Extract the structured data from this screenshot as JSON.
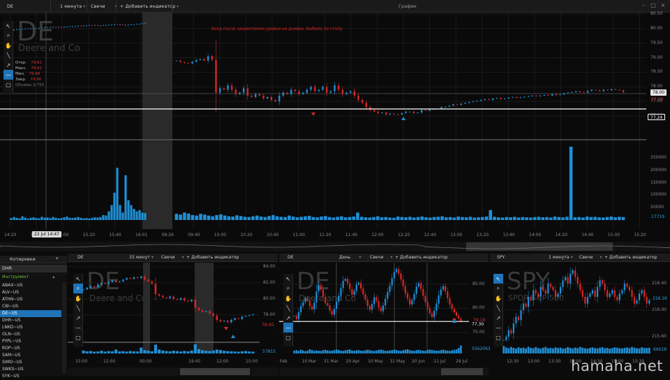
{
  "topbar": {
    "symbol": "DE",
    "interval": "1 минута",
    "chart_type": "Свечи",
    "add_indicator": "+ Добавить индикатор",
    "window_title": "График"
  },
  "main_chart": {
    "watermark": "DE",
    "company": "Deere and Co",
    "ohlc": [
      {
        "label": "Откр.",
        "value": "79.62"
      },
      {
        "label": "Макс.",
        "value": "79.62"
      },
      {
        "label": "Мин.",
        "value": "79.66"
      },
      {
        "label": "Закр.",
        "value": "79.66"
      }
    ],
    "volume_label": "Объемы",
    "volume_value": "9,755",
    "annotation": "Вход после закрепления уровня на дневке. Выбило по стопу",
    "price_ticks": [
      "80.50",
      "80.00",
      "79.50",
      "79.00",
      "78.50",
      "78.00",
      "77.50",
      "77.00"
    ],
    "current_price": "78.00",
    "level_price": "77.24",
    "stop_price": "77.79",
    "volume_ticks": [
      "250000",
      "200000",
      "150000",
      "100000",
      "50000"
    ],
    "last_volume": "17719",
    "time_ticks": [
      "14:20",
      "14:40",
      "15:00",
      "15:20",
      "15:40",
      "16:01",
      "08:26",
      "09:40",
      "10:00",
      "10:20",
      "10:40",
      "11:00",
      "11:20",
      "11:40",
      "12:00",
      "12:20",
      "12:40",
      "13:00",
      "13:20",
      "13:40",
      "14:00",
      "14:20",
      "14:40",
      "15:00",
      "15:20"
    ],
    "cursor_time": "22 Jul 14:47",
    "candles": [
      79.94,
      79.96,
      79.97,
      79.98,
      80.0,
      80.0,
      79.99,
      80.0,
      80.01,
      80.01,
      80.02,
      80.03,
      80.05,
      80.04,
      80.05,
      80.06,
      80.05,
      80.06,
      80.05,
      80.06,
      80.07,
      80.08,
      80.08,
      80.08,
      80.1,
      80.09,
      80.1,
      80.11,
      80.12,
      80.11,
      80.12,
      80.11,
      80.11,
      80.12,
      80.12,
      80.13,
      80.13,
      80.15,
      80.14,
      80.14,
      80.12,
      80.13,
      80.13,
      80.14,
      80.15,
      80.16,
      80.16,
      80.18,
      80.2,
      78.9,
      78.85,
      78.82,
      78.8,
      78.86,
      78.92,
      78.95,
      78.9,
      79.05,
      78.93,
      77.8,
      77.95,
      77.9,
      78.05,
      77.9,
      77.75,
      77.8,
      77.95,
      77.7,
      77.65,
      77.75,
      77.7,
      77.6,
      77.65,
      77.55,
      77.5,
      77.7,
      77.8,
      77.75,
      77.9,
      77.85,
      77.75,
      77.8,
      77.9,
      78.0,
      77.85,
      77.9,
      78.0,
      77.8,
      77.85,
      78.05,
      77.9,
      77.75,
      77.8,
      77.85,
      77.7,
      77.55,
      77.45,
      77.3,
      77.2,
      77.15,
      77.1,
      77.12,
      77.05,
      77.08,
      77.06,
      77.05,
      77.1,
      77.15,
      77.15,
      77.1,
      77.12,
      77.2,
      77.18,
      77.22,
      77.24,
      77.25,
      77.3,
      77.32,
      77.35,
      77.4,
      77.38,
      77.42,
      77.45,
      77.48,
      77.5,
      77.52,
      77.55,
      77.58,
      77.55,
      77.6,
      77.62,
      77.58,
      77.6,
      77.63,
      77.65,
      77.62,
      77.64,
      77.66,
      77.68,
      77.7,
      77.68,
      77.7,
      77.72,
      77.7,
      77.75,
      77.72,
      77.74,
      77.78,
      77.8,
      77.82,
      77.85,
      77.82,
      77.8,
      77.86,
      77.9,
      77.88,
      77.85,
      77.9,
      77.88,
      77.92,
      77.9,
      77.88,
      77.82
    ],
    "volumes": [
      8000,
      12000,
      9000,
      7000,
      15000,
      10000,
      6000,
      9000,
      11000,
      8000,
      7000,
      13000,
      9000,
      10000,
      8000,
      12000,
      9000,
      7000,
      8000,
      11000,
      14000,
      9000,
      8000,
      10000,
      12000,
      9000,
      7000,
      8000,
      6000,
      9000,
      11000,
      10000,
      12000,
      20000,
      18000,
      35000,
      60000,
      110000,
      210000,
      60000,
      30000,
      180000,
      80000,
      60000,
      45000,
      35000,
      40000,
      30000,
      28000,
      25000,
      22000,
      30000,
      26000,
      20000,
      18000,
      25000,
      22000,
      18000,
      15000,
      20000,
      23000,
      18000,
      15000,
      14000,
      19000,
      16000,
      13000,
      12000,
      15000,
      18000,
      14000,
      12000,
      16000,
      20000,
      15000,
      13000,
      12000,
      18000,
      14000,
      11000,
      13000,
      15000,
      17000,
      12000,
      11000,
      14000,
      16000,
      12000,
      10000,
      13000,
      15000,
      11000,
      12000,
      14000,
      30000,
      13000,
      11000,
      10000,
      12000,
      15000,
      11000,
      12000,
      10000,
      9000,
      14000,
      12000,
      11000,
      13000,
      10000,
      12000,
      14000,
      11000,
      10000,
      12000,
      13000,
      15000,
      11000,
      12000,
      10000,
      14000,
      12000,
      11000,
      13000,
      10000,
      11000,
      12000,
      14000,
      40000,
      13000,
      11000,
      10000,
      12000,
      11000,
      13000,
      10000,
      12000,
      11000,
      10000,
      12000,
      13000,
      11000,
      12000,
      10000,
      14000,
      12000,
      11000,
      13000,
      295000,
      11000,
      12000,
      10000,
      14000,
      12000,
      13000,
      11000,
      10000,
      12000,
      14000,
      11000,
      13000,
      12000
    ]
  },
  "watchlist": {
    "title": "Котировки",
    "search_value": "DHR",
    "group": "Инструмент",
    "items": [
      "ABAX~US",
      "ALV~US",
      "ATHN~US",
      "CBI~US",
      "DE~US",
      "DHR~US",
      "LNKD~US",
      "OLN~US",
      "PYPL~US",
      "ROP~US",
      "SAM~US",
      "SIMO~US",
      "SWKS~US",
      "SYK~US"
    ],
    "selected": "DE~US"
  },
  "panel1": {
    "symbol": "DE",
    "interval": "15 минут",
    "chart_type": "Свечи",
    "add_indicator": "+ Добавить индикатор",
    "watermark": "DE",
    "company": "Deere and Co",
    "price_ticks": [
      "84.00",
      "82.00",
      "80.00",
      "78.00"
    ],
    "price_box": "78.00",
    "last_volume": "57815",
    "time_ticks": [
      "15:00",
      "12:00",
      "00:00",
      "19:45",
      "12:00",
      "15:00"
    ],
    "candles": [
      81.2,
      81.4,
      81.6,
      81.5,
      81.8,
      82.0,
      81.9,
      82.1,
      82.3,
      82.1,
      82.2,
      82.4,
      82.6,
      82.5,
      82.7,
      82.6,
      82.8,
      82.4,
      82.2,
      81.9,
      80.6,
      80.4,
      80.2,
      80.1,
      80.3,
      80.0,
      79.9,
      80.1,
      79.8,
      79.7,
      79.9,
      78.9,
      78.6,
      78.4,
      78.5,
      78.2,
      77.9,
      77.4,
      77.2,
      77.3,
      77.1,
      77.4,
      77.6,
      77.5,
      77.8,
      77.9,
      78.0,
      78.1
    ],
    "volumes": [
      30,
      22,
      25,
      18,
      20,
      28,
      19,
      24,
      22,
      40,
      21,
      23,
      19,
      25,
      22,
      20,
      60,
      35,
      28,
      22,
      90,
      40,
      30,
      25,
      22,
      28,
      24,
      20,
      26,
      22,
      30,
      95,
      45,
      33,
      28,
      25,
      30,
      40,
      35,
      28,
      24,
      22,
      20,
      18,
      22,
      25,
      20,
      18
    ]
  },
  "panel2": {
    "symbol": "DE",
    "interval": "День",
    "chart_type": "Свечи",
    "add_indicator": "+ Добавить индикатор",
    "watermark": "DE",
    "company": "Deere and Co",
    "price_ticks": [
      "85.00",
      "80.00",
      "75.00"
    ],
    "price_box": "77.30",
    "stop_price": "79.18",
    "last_volume": "5562063",
    "time_ticks": [
      "Feb",
      "10 Mar",
      "31 Mar",
      "20 Apr",
      "10 May",
      "31 May",
      "20 Jun",
      "11 Jul",
      "29 Jul"
    ],
    "candles": [
      78.5,
      77.8,
      79.2,
      80.5,
      81.3,
      82.1,
      81.6,
      80.4,
      79.8,
      81.2,
      83.5,
      84.8,
      83.9,
      82.4,
      81.1,
      80.6,
      79.5,
      78.7,
      79.9,
      81.4,
      82.6,
      84.2,
      85.7,
      86.1,
      85.2,
      84.0,
      82.8,
      83.6,
      84.9,
      85.3,
      84.1,
      82.9,
      81.8,
      80.5,
      79.7,
      80.9,
      82.3,
      81.5,
      80.2,
      79.4,
      80.6,
      82.0,
      83.4,
      84.7,
      86.2,
      87.5,
      88.1,
      87.2,
      86.0,
      84.6,
      83.1,
      82.0,
      80.8,
      81.7,
      83.0,
      84.5,
      85.2,
      84.0,
      82.6,
      81.3,
      80.1,
      79.0,
      78.2,
      79.5,
      81.0,
      82.7,
      83.9,
      84.6,
      83.5,
      82.1,
      80.8,
      79.9,
      79.2,
      78.5,
      77.9,
      77.3
    ],
    "volumes": [
      30,
      35,
      28,
      40,
      33,
      25,
      30,
      45,
      38,
      28,
      32,
      30,
      27,
      35,
      40,
      33,
      28,
      30,
      36,
      42,
      38,
      30,
      28,
      34,
      39,
      44,
      31,
      29,
      33,
      37,
      30,
      28,
      35,
      40,
      36,
      30,
      27,
      33,
      38,
      42,
      35,
      30,
      28,
      32,
      36,
      41,
      38,
      30,
      28,
      34,
      40,
      45,
      36,
      30,
      29,
      35,
      39,
      33,
      30,
      28,
      37,
      42,
      38,
      33,
      30,
      29,
      36,
      41,
      35,
      31,
      28,
      34,
      39,
      44,
      60,
      85
    ]
  },
  "panel3": {
    "symbol": "SPY",
    "interval": "1 минута",
    "chart_type": "Свечи",
    "add_indicator": "+ Добавить индикатор",
    "watermark": "SPY",
    "company": "SPDR S&P 500",
    "price_ticks": [
      "216.40",
      "216.00",
      "215.60"
    ],
    "price_box": "216.26",
    "last_volume": "66018",
    "time_ticks": [
      "12:30",
      "13:00",
      "13:30",
      "14:00",
      "14:30",
      "15:00",
      "15:30"
    ],
    "candles": [
      215.55,
      215.6,
      215.7,
      215.65,
      215.8,
      215.9,
      215.85,
      216.0,
      216.1,
      216.05,
      216.2,
      216.15,
      216.3,
      216.25,
      216.2,
      216.35,
      216.3,
      216.25,
      216.4,
      216.35,
      216.3,
      216.2,
      216.25,
      216.35,
      216.45,
      216.5,
      216.4,
      216.55,
      216.6,
      216.5,
      216.4,
      216.3,
      216.2,
      216.1,
      216.2,
      216.25,
      216.3,
      216.2,
      216.35,
      216.45,
      216.4,
      216.3,
      216.2,
      216.25,
      216.3,
      216.2,
      216.15,
      216.25,
      216.3,
      216.4,
      216.35,
      216.3,
      216.2,
      216.1,
      216.15,
      216.25,
      216.3,
      216.2,
      216.1,
      216.15
    ],
    "volumes": [
      40,
      32,
      28,
      35,
      30,
      26,
      33,
      29,
      31,
      27,
      36,
      30,
      28,
      34,
      29,
      26,
      31,
      35,
      28,
      30,
      27,
      33,
      29,
      31,
      26,
      28,
      34,
      30,
      27,
      32,
      29,
      35,
      31,
      28,
      26,
      30,
      33,
      29,
      27,
      31,
      34,
      28,
      30,
      26,
      29,
      33,
      31,
      28,
      27,
      30,
      32,
      29,
      35,
      31,
      28,
      27,
      33,
      30,
      29,
      31
    ]
  },
  "brand": "hamaha.net",
  "colors": {
    "up": "#1f8fd6",
    "down": "#d52828",
    "accent": "#1f73b7",
    "level": "#ffffff"
  }
}
